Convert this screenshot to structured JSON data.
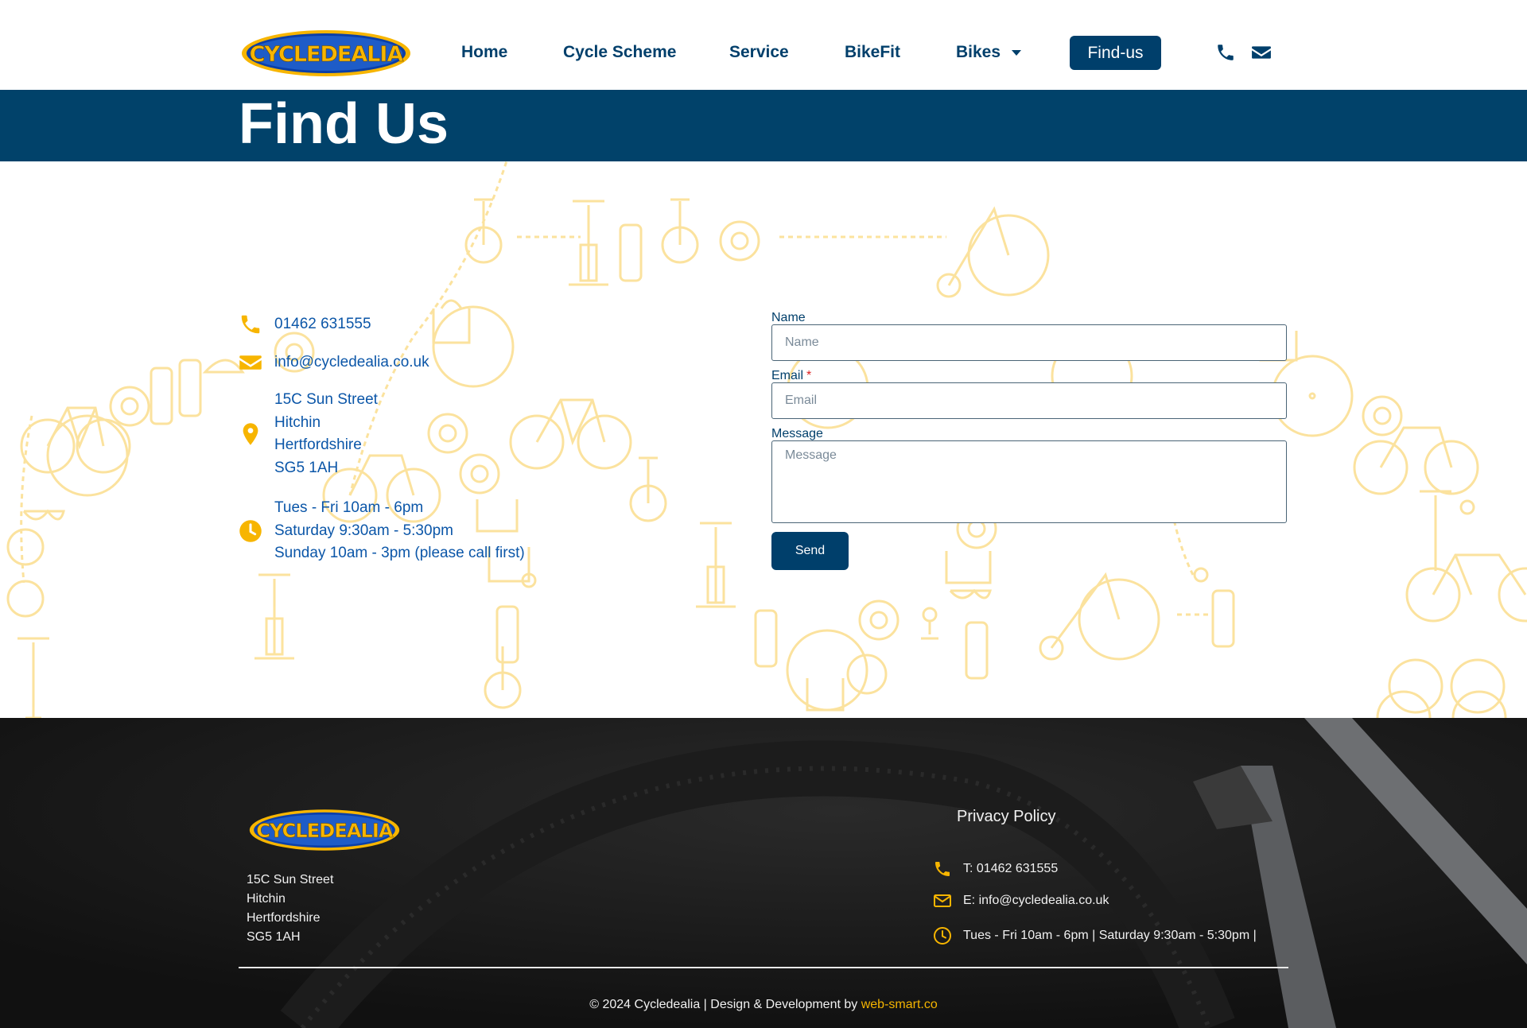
{
  "brand": {
    "logo_text": "CYCLEDEALIA",
    "colors": {
      "navy": "#003f6b",
      "band": "#01426a",
      "yellow": "#f7b500",
      "link_blue": "#0b56a8",
      "footer_bg": "#121212"
    }
  },
  "nav": {
    "items": [
      {
        "label": "Home"
      },
      {
        "label": "Cycle Scheme"
      },
      {
        "label": "Service"
      },
      {
        "label": "BikeFit"
      },
      {
        "label": "Bikes",
        "has_dropdown": true
      }
    ],
    "cta_label": "Find-us",
    "icons": [
      "phone-icon",
      "envelope-icon"
    ]
  },
  "page": {
    "title": "Find Us"
  },
  "contact": {
    "phone": "01462 631555",
    "email": "info@cycledealia.co.uk",
    "address": [
      "15C Sun Street",
      "Hitchin",
      "Hertfordshire",
      "SG5 1AH"
    ],
    "hours": [
      "Tues - Fri 10am - 6pm",
      "Saturday 9:30am - 5:30pm",
      "Sunday 10am - 3pm (please call first)"
    ]
  },
  "form": {
    "name_label": "Name",
    "name_placeholder": "Name",
    "email_label": "Email",
    "email_required_mark": "*",
    "email_placeholder": "Email",
    "message_label": "Message",
    "message_placeholder": "Message",
    "send_label": "Send"
  },
  "footer": {
    "logo_text": "CYCLEDEALIA",
    "address": [
      "15C Sun Street",
      "Hitchin",
      "Hertfordshire",
      "SG5 1AH"
    ],
    "privacy_label": "Privacy Policy",
    "phone": "T: 01462 631555",
    "email": "E: info@cycledealia.co.uk",
    "hours": "Tues - Fri 10am - 6pm | Saturday 9:30am - 5:30pm |",
    "copyright": "© 2024 Cycledealia | Design & Development by",
    "credit": "web-smart.co"
  }
}
